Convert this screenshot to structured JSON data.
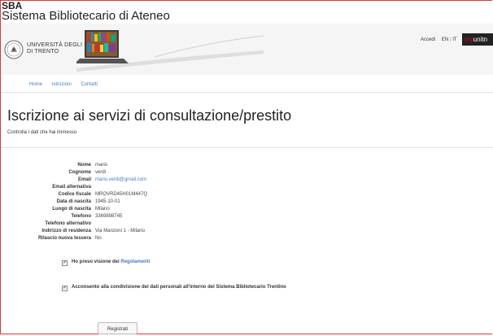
{
  "header": {
    "brand_title": "SBA",
    "brand_subtitle": "Sistema Bibliotecario di Ateneo",
    "university_name_line1": "UNIVERSITÀ DEGLI STUDI",
    "university_name_line2": "DI TRENTO",
    "login": "Accedi",
    "lang_en": "EN",
    "lang_sep": "|",
    "lang_it": "IT",
    "portal_my": "my",
    "portal_unitn": "unitn"
  },
  "nav": {
    "items": [
      "Home",
      "Istruzioni",
      "Contatti"
    ]
  },
  "page": {
    "title": "Iscrizione ai servizi di consultazione/prestito",
    "subtitle": "Controlla i dati che hai immesso"
  },
  "form": {
    "rows": [
      {
        "label": "Nome",
        "value": "mario"
      },
      {
        "label": "Cognome",
        "value": "verdi"
      },
      {
        "label": "Email",
        "value": "mario.verdi@gmail.com"
      },
      {
        "label": "Email alternativa",
        "value": ""
      },
      {
        "label": "Codice fiscale",
        "value": "MROVRD45H01M447Q"
      },
      {
        "label": "Data di nascita",
        "value": "1945-10-01"
      },
      {
        "label": "Luogo di nascita",
        "value": "Milano"
      },
      {
        "label": "Telefono",
        "value": "3369898745"
      },
      {
        "label": "Telefono alternativo",
        "value": ""
      },
      {
        "label": "Indirizzo di residenza",
        "value": "Via Manzoni 1 - Milano"
      },
      {
        "label": "Rilascio nuova tessera",
        "value": "No"
      }
    ]
  },
  "consent": {
    "regolamenti_text": "Ho preso visione dei ",
    "regolamenti_link": "Regolamenti",
    "privacy_text": "Acconsento alla condivisione dei dati personali all'interno del Sistema Bibliotecario Trentino",
    "check_mark": "✔"
  },
  "actions": {
    "submit": "Registrati"
  },
  "colors": {
    "link": "#4a7cbf",
    "frame": "#d23c3c",
    "brand_red": "#e4002b"
  }
}
